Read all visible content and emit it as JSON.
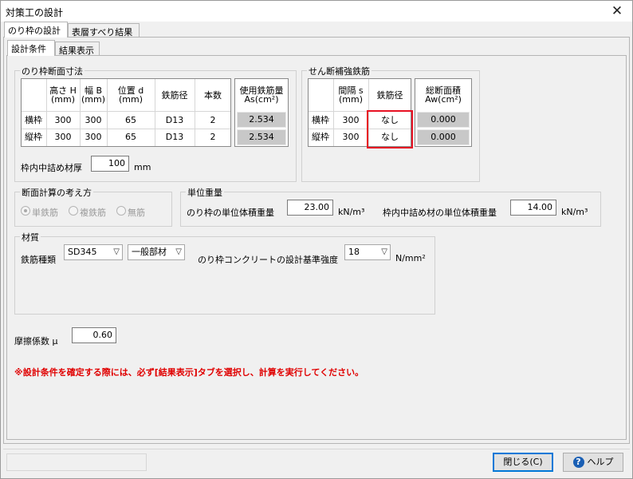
{
  "window": {
    "title": "対策工の設計",
    "close_glyph": "✕"
  },
  "tabs_top": [
    "のり枠の設計",
    "表層すべり結果"
  ],
  "tabs_sub": [
    "設計条件",
    "結果表示"
  ],
  "frame_section": {
    "title": "のり枠断面寸法",
    "headers": [
      {
        "line1": "高さ H",
        "line2": "(mm)"
      },
      {
        "line1": "幅 B",
        "line2": "(mm)"
      },
      {
        "line1": "位置 d",
        "line2": "(mm)"
      },
      {
        "line1": "鉄筋径",
        "line2": ""
      },
      {
        "line1": "本数",
        "line2": ""
      }
    ],
    "rows": [
      {
        "label": "横枠",
        "values": [
          "300",
          "300",
          "65",
          "D13",
          "2"
        ]
      },
      {
        "label": "縦枠",
        "values": [
          "300",
          "300",
          "65",
          "D13",
          "2"
        ]
      }
    ],
    "used_rebar": {
      "line1": "使用鉄筋量",
      "line2": "As(cm²)",
      "values": [
        "2.534",
        "2.534"
      ]
    },
    "fill_thickness_label": "枠内中詰め材厚",
    "fill_thickness_value": "100",
    "fill_thickness_unit": "mm"
  },
  "shear_section": {
    "title": "せん断補強鉄筋",
    "headers": [
      {
        "line1": "間隔 s",
        "line2": "(mm)"
      },
      {
        "line1": "鉄筋径",
        "line2": ""
      }
    ],
    "rows": [
      {
        "label": "横枠",
        "spacing": "300",
        "dia": "なし"
      },
      {
        "label": "縦枠",
        "spacing": "300",
        "dia": "なし"
      }
    ],
    "total_area": {
      "line1": "総断面積",
      "line2": "Aw(cm²)",
      "values": [
        "0.000",
        "0.000"
      ]
    }
  },
  "calc_method": {
    "title": "断面計算の考え方",
    "options": [
      "単鉄筋",
      "複鉄筋",
      "無筋"
    ],
    "selected": "単鉄筋"
  },
  "unit_weight": {
    "title": "単位重量",
    "frame_label": "のり枠の単位体積重量",
    "frame_value": "23.00",
    "frame_unit": "kN/m³",
    "fill_label": "枠内中詰め材の単位体積重量",
    "fill_value": "14.00",
    "fill_unit": "kN/m³"
  },
  "material": {
    "title": "材質",
    "rebar_type_label": "鉄筋種類",
    "rebar_type": "SD345",
    "member_type": "一般部材",
    "concrete_label": "のり枠コンクリートの設計基準強度",
    "concrete_strength": "18",
    "concrete_unit": "N/mm²"
  },
  "friction": {
    "label": "摩擦係数 μ",
    "value": "0.60"
  },
  "notice": "※設計条件を確定する際には、必ず[結果表示]タブを選択し、計算を実行してください。",
  "buttons": {
    "close": "閉じる(C)",
    "help": "ヘルプ",
    "help_glyph": "?"
  },
  "colors": {
    "highlight_red": "#e81123",
    "notice_red": "#e00000",
    "readonly_gray": "#c8c8c8",
    "help_blue": "#1a5fb4"
  }
}
